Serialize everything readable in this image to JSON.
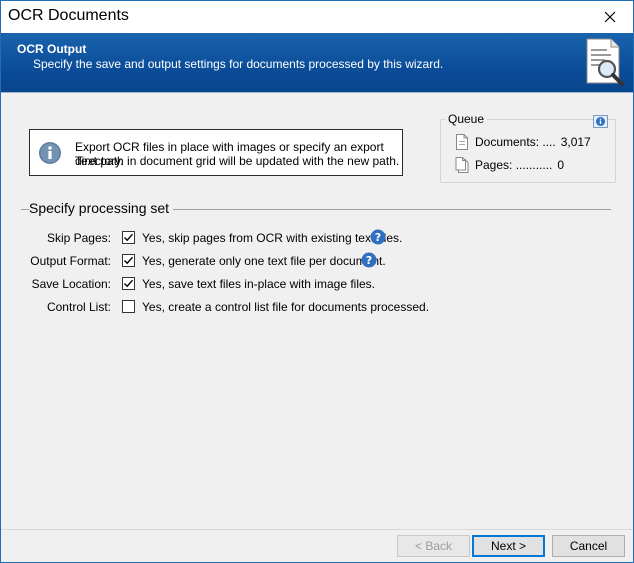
{
  "window": {
    "title": "OCR Documents"
  },
  "banner": {
    "title": "OCR Output",
    "subtitle": "Specify the save and output settings for documents processed by this wizard."
  },
  "info": {
    "line1": "Export OCR files in place with images or specify an export directory.",
    "line2": "Text path in document grid will be updated with the new path."
  },
  "queue": {
    "legend": "Queue",
    "documents_label": "Documents: ....",
    "documents_value": "3,017",
    "pages_label": "Pages: ...........",
    "pages_value": "0"
  },
  "section": {
    "title": "Specify processing set"
  },
  "options": [
    {
      "label": "Skip Pages:",
      "text": "Yes, skip pages from OCR with existing text files.",
      "checked": true,
      "help": true
    },
    {
      "label": "Output Format:",
      "text": "Yes, generate only one text file per document.",
      "checked": true,
      "help": true
    },
    {
      "label": "Save Location:",
      "text": "Yes, save text files in-place with image files.",
      "checked": true,
      "help": false
    },
    {
      "label": "Control List:",
      "text": "Yes, create a control list file for documents processed.",
      "checked": false,
      "help": false
    }
  ],
  "buttons": {
    "back": "< Back",
    "next": "Next >",
    "cancel": "Cancel"
  },
  "colors": {
    "banner": "#0b4d99",
    "accent": "#0078d7",
    "help": "#2f6fc0"
  }
}
